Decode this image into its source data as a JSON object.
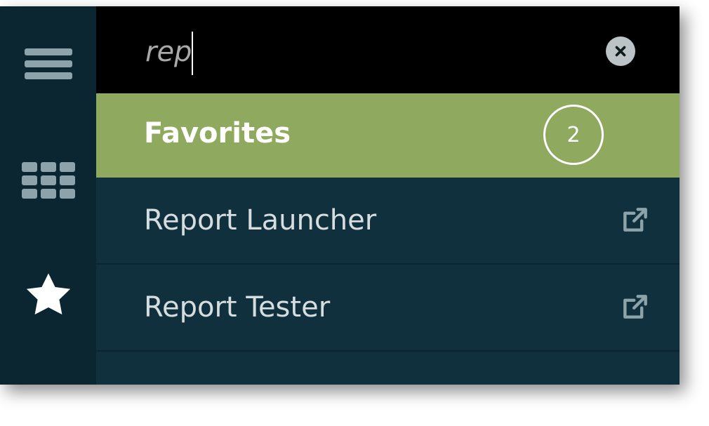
{
  "colors": {
    "rail_bg": "#0c2631",
    "panel_bg": "#10303d",
    "search_bg": "#000000",
    "favorites_bg": "#8faa5f",
    "icon_gray": "#8da3ab",
    "text_light": "#d6dddf",
    "white": "#ffffff"
  },
  "rail": {
    "icons": [
      "hamburger-menu-icon",
      "apps-grid-icon",
      "star-icon"
    ]
  },
  "search": {
    "value": "rep",
    "placeholder": ""
  },
  "favorites": {
    "label": "Favorites",
    "count": "2"
  },
  "items": [
    {
      "label": "Report Launcher",
      "icon": "external-link-icon"
    },
    {
      "label": "Report Tester",
      "icon": "external-link-icon"
    }
  ]
}
